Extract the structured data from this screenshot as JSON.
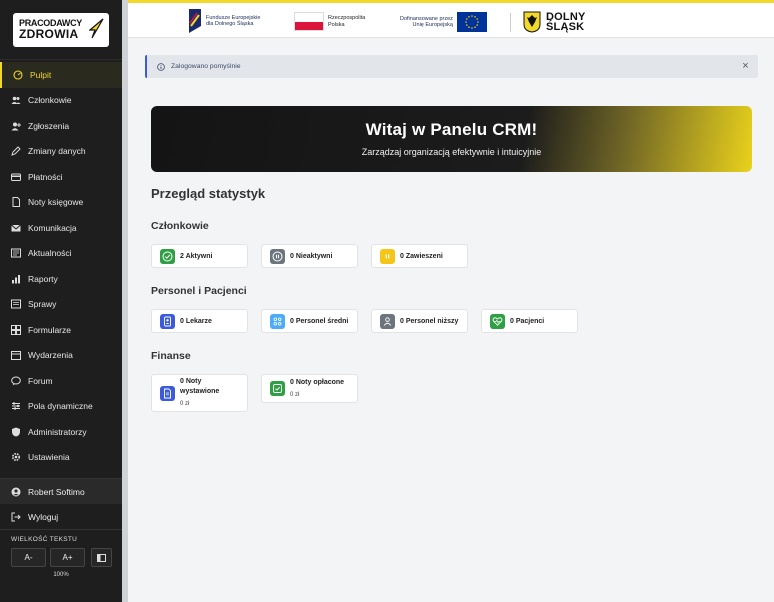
{
  "logo": {
    "line1": "PRACODAWCY",
    "line2": "ZDROWIA"
  },
  "sidebar": {
    "items": [
      {
        "label": "Pulpit",
        "icon": "dashboard-icon"
      },
      {
        "label": "Członkowie",
        "icon": "users-icon"
      },
      {
        "label": "Zgłoszenia",
        "icon": "user-plus-icon"
      },
      {
        "label": "Zmiany danych",
        "icon": "edit-icon"
      },
      {
        "label": "Płatności",
        "icon": "credit-card-icon"
      },
      {
        "label": "Noty księgowe",
        "icon": "document-icon"
      },
      {
        "label": "Komunikacja",
        "icon": "mail-icon"
      },
      {
        "label": "Aktualności",
        "icon": "news-icon"
      },
      {
        "label": "Raporty",
        "icon": "bar-chart-icon"
      },
      {
        "label": "Sprawy",
        "icon": "folder-icon"
      },
      {
        "label": "Formularze",
        "icon": "form-icon"
      },
      {
        "label": "Wydarzenia",
        "icon": "calendar-icon"
      },
      {
        "label": "Forum",
        "icon": "chat-icon"
      },
      {
        "label": "Pola dynamiczne",
        "icon": "sliders-icon"
      },
      {
        "label": "Administratorzy",
        "icon": "shield-icon"
      },
      {
        "label": "Ustawienia",
        "icon": "gear-icon"
      }
    ],
    "user": "Robert Softimo",
    "logout": "Wyloguj",
    "text_size": {
      "caption": "WIELKOŚĆ TEKSTU",
      "decrease": "A-",
      "increase": "A+",
      "percent": "100%"
    }
  },
  "banner": {
    "fe_line1": "Fundusze Europejskie",
    "fe_line2": "dla Dolnego Śląska",
    "rp_line1": "Rzeczpospolita",
    "rp_line2": "Polska",
    "eu_line1": "Dofinansowane przez",
    "eu_line2": "Unię Europejską",
    "ds_line1": "DOLNY",
    "ds_line2": "ŚLĄSK"
  },
  "alert": {
    "text": "Zalogowano pomyślnie",
    "close": "×"
  },
  "hero": {
    "title": "Witaj w Panelu CRM!",
    "subtitle": "Zarządzaj organizacją efektywnie i intuicyjnie"
  },
  "stats": {
    "title": "Przegląd statystyk",
    "members": {
      "title": "Członkowie",
      "active": "2 Aktywni",
      "inactive": "0 Nieaktywni",
      "suspended": "0 Zawieszeni"
    },
    "staff": {
      "title": "Personel i Pacjenci",
      "doctors": "0 Lekarze",
      "mid": "0 Personel średni",
      "low": "0 Personel niższy",
      "patients": "0 Pacjenci"
    },
    "finance": {
      "title": "Finanse",
      "issued_line1": "0 Noty",
      "issued_line2": "wystawione",
      "issued_amount": "0 zł",
      "paid": "0 Noty opłacone",
      "paid_amount": "0 zł"
    }
  },
  "colors": {
    "accent": "#f2d82a",
    "sidebar_bg": "#1e1e1e",
    "green": "#2f9e44",
    "gray": "#6c757d",
    "yellow": "#f5c518",
    "blue": "#3b5bdb",
    "cyan": "#4dabf7"
  }
}
